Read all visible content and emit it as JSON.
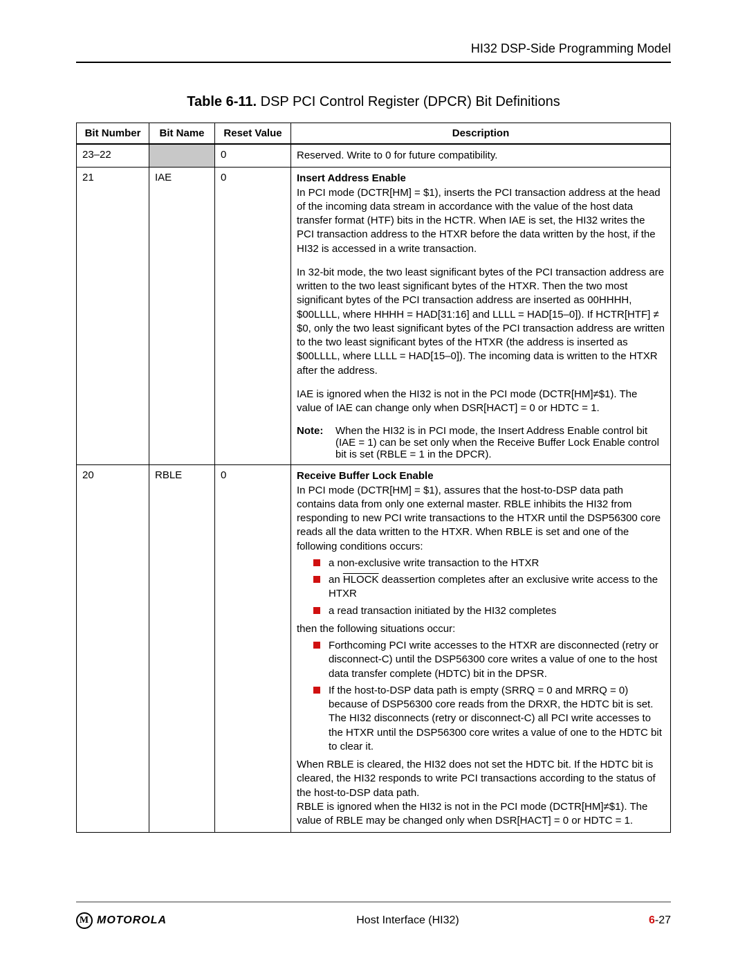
{
  "header": {
    "section": "HI32 DSP-Side Programming Model"
  },
  "caption": {
    "prefix": "Table 6-11.",
    "title": " DSP PCI Control Register (DPCR) Bit Definitions"
  },
  "columns": {
    "bitNumber": "Bit Number",
    "bitName": "Bit Name",
    "resetValue": "Reset Value",
    "description": "Description"
  },
  "rows": {
    "r0": {
      "bitNumber": "23–22",
      "bitName": "",
      "resetValue": "0",
      "desc": "Reserved. Write to 0 for future compatibility."
    },
    "r1": {
      "bitNumber": "21",
      "bitName": "IAE",
      "resetValue": "0",
      "title": "Insert Address Enable",
      "p1": "In PCI mode (DCTR[HM] = $1), inserts the PCI transaction address at the head of the incoming data stream in accordance with the value of the host data transfer format (HTF) bits in the HCTR. When IAE is set, the HI32 writes the PCI transaction address to the HTXR before the data written by the host, if the HI32 is accessed in a write transaction.",
      "p2": "In 32-bit mode, the two least significant bytes of the PCI transaction address are written to the two least significant bytes of the HTXR. Then the two most significant bytes of the PCI transaction address are inserted as 00HHHH, $00LLLL, where HHHH = HAD[31:16] and LLLL = HAD[15–0]). If HCTR[HTF] ≠ $0, only the two least significant bytes of the PCI transaction address are written to the two least significant bytes of the HTXR (the address is inserted as $00LLLL, where LLLL = HAD[15–0]). The incoming data is written to the HTXR after the address.",
      "p3": "IAE is ignored when the HI32 is not in the PCI mode (DCTR[HM]≠$1). The value of IAE can change only when DSR[HACT] = 0 or HDTC = 1.",
      "noteLabel": "Note:",
      "noteText": "When the HI32 is in PCI mode, the Insert Address Enable control bit (IAE = 1) can be set only when the Receive Buffer Lock Enable control bit is set (RBLE = 1 in the DPCR)."
    },
    "r2": {
      "bitNumber": "20",
      "bitName": "RBLE",
      "resetValue": "0",
      "title": "Receive Buffer Lock Enable",
      "p1": "In PCI mode (DCTR[HM] = $1), assures that the host-to-DSP data path contains data from only one external master. RBLE inhibits the HI32 from responding to new PCI write transactions to the HTXR until the DSP56300 core reads all the data written to the HTXR. When RBLE is set and one of the following conditions occurs:",
      "b1a": "a non-exclusive write transaction to the HTXR",
      "b1b_pre": "an ",
      "b1b_ov": "HLOCK",
      "b1b_post": " deassertion completes after an exclusive write access to the HTXR",
      "b1c": "a read transaction initiated by the HI32 completes",
      "p2": "then the following situations occur:",
      "b2a": "Forthcoming PCI write accesses to the HTXR are disconnected (retry or disconnect-C) until the DSP56300 core writes a value of one to the host data transfer complete (HDTC) bit in the DPSR.",
      "b2b": "If the host-to-DSP data path is empty (SRRQ = 0 and MRRQ = 0) because of DSP56300 core reads from the DRXR, the HDTC bit is set. The HI32 disconnects (retry or disconnect-C) all PCI write accesses to the HTXR until the DSP56300 core writes a value of one to the HDTC bit to clear it.",
      "p3": "When RBLE is cleared, the HI32 does not set the HDTC bit. If the HDTC bit is cleared, the HI32 responds to write PCI transactions according to the status of the host-to-DSP data path.",
      "p4": "RBLE is ignored when the HI32 is not in the PCI mode (DCTR[HM]≠$1). The value of RBLE may be changed only when DSR[HACT] = 0 or HDTC = 1."
    }
  },
  "footer": {
    "brand": "MOTOROLA",
    "center": "Host Interface (HI32)",
    "chapter": "6",
    "page": "-27"
  }
}
